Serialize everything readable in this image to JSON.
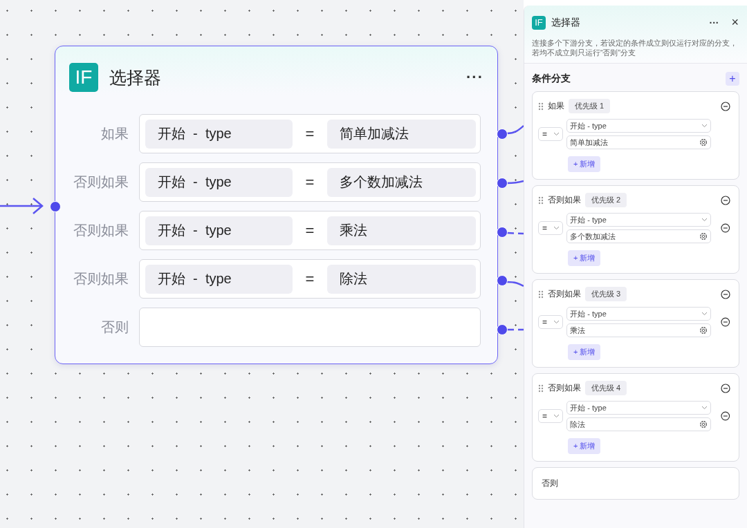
{
  "node": {
    "logo": "IF",
    "title": "选择器",
    "more": "···",
    "rows": [
      {
        "kind": "condition",
        "label": "如果",
        "left": "开始  -  type",
        "operator": "=",
        "value": "简单加减法"
      },
      {
        "kind": "condition",
        "label": "否则如果",
        "left": "开始  -  type",
        "operator": "=",
        "value": "多个数加减法"
      },
      {
        "kind": "condition",
        "label": "否则如果",
        "left": "开始  -  type",
        "operator": "=",
        "value": "乘法"
      },
      {
        "kind": "condition",
        "label": "否则如果",
        "left": "开始  -  type",
        "operator": "=",
        "value": "除法"
      },
      {
        "kind": "else",
        "label": "否则"
      }
    ]
  },
  "panel": {
    "logo": "IF",
    "title": "选择器",
    "more": "···",
    "close": "×",
    "description": "连接多个下游分支，若设定的条件成立则仅运行对应的分支，若均不成立则只运行“否则”分支",
    "section_title": "条件分支",
    "add": "+",
    "branches": [
      {
        "label": "如果",
        "priority": "优先级 1",
        "operator": "=",
        "field": "开始 - type",
        "value": "简单加减法",
        "deletable": false,
        "add_button": "+ 新增"
      },
      {
        "label": "否则如果",
        "priority": "优先级 2",
        "operator": "=",
        "field": "开始 - type",
        "value": "多个数加减法",
        "deletable": true,
        "add_button": "+ 新增"
      },
      {
        "label": "否则如果",
        "priority": "优先级 3",
        "operator": "=",
        "field": "开始 - type",
        "value": "乘法",
        "deletable": true,
        "add_button": "+ 新增"
      },
      {
        "label": "否则如果",
        "priority": "优先级 4",
        "operator": "=",
        "field": "开始 - type",
        "value": "除法",
        "deletable": true,
        "add_button": "+ 新增"
      }
    ],
    "else_label": "否则"
  }
}
